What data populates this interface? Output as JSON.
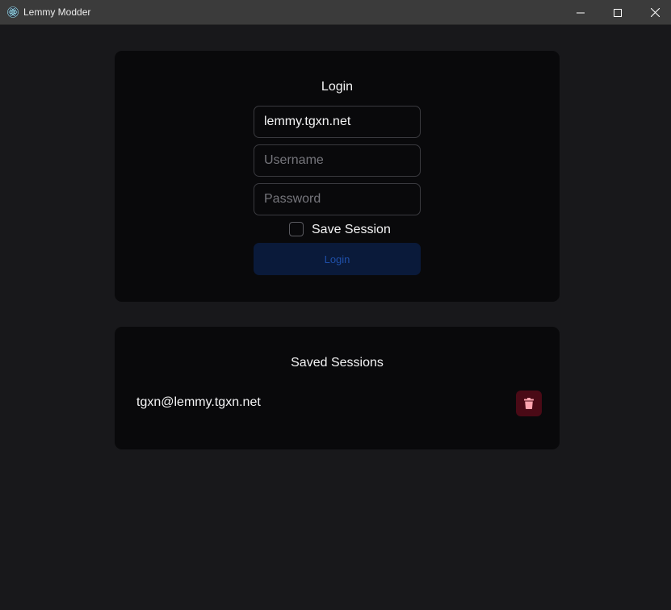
{
  "window": {
    "title": "Lemmy Modder",
    "app_icon": "electron-atom-icon",
    "controls": [
      "minimize",
      "maximize",
      "close"
    ]
  },
  "login": {
    "heading": "Login",
    "instance_value": "lemmy.tgxn.net",
    "username_placeholder": "Username",
    "password_placeholder": "Password",
    "save_session_label": "Save Session",
    "save_session_checked": false,
    "submit_label": "Login",
    "submit_disabled": true
  },
  "sessions": {
    "heading": "Saved Sessions",
    "items": [
      {
        "label": "tgxn@lemmy.tgxn.net",
        "action_icon": "trash-icon"
      }
    ]
  },
  "colors": {
    "background": "#18181b",
    "card": "#09090b",
    "primary_disabled": "#0a1a3a",
    "danger": "#4a0a16",
    "danger_icon": "#fda4af"
  }
}
